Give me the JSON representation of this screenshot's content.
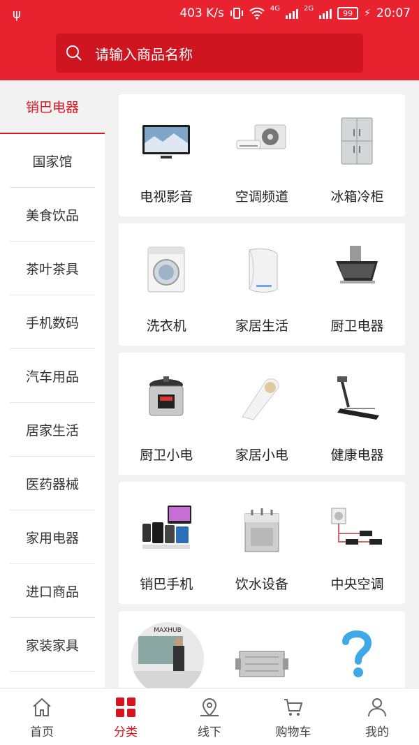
{
  "status_bar": {
    "usb_icon": "usb-icon",
    "speed": "403 K/s",
    "net_4g": "4G",
    "net_2g": "2G",
    "battery": "99",
    "time": "20:07"
  },
  "search": {
    "placeholder": "请输入商品名称",
    "icon": "search-icon"
  },
  "sidebar": {
    "items": [
      {
        "label": "销巴电器"
      },
      {
        "label": "国家馆"
      },
      {
        "label": "美食饮品"
      },
      {
        "label": "茶叶茶具"
      },
      {
        "label": "手机数码"
      },
      {
        "label": "汽车用品"
      },
      {
        "label": "居家生活"
      },
      {
        "label": "医药器械"
      },
      {
        "label": "家用电器"
      },
      {
        "label": "进口商品"
      },
      {
        "label": "家装家具"
      }
    ],
    "active": "销巴电器"
  },
  "categories": {
    "groups": [
      {
        "items": [
          {
            "label": "电视影音",
            "icon": "tv"
          },
          {
            "label": "空调频道",
            "icon": "air-conditioner"
          },
          {
            "label": "冰箱冷柜",
            "icon": "fridge"
          }
        ]
      },
      {
        "items": [
          {
            "label": "洗衣机",
            "icon": "washer"
          },
          {
            "label": "家居生活",
            "icon": "air-purifier"
          },
          {
            "label": "厨卫电器",
            "icon": "range-hood"
          }
        ]
      },
      {
        "items": [
          {
            "label": "厨卫小电",
            "icon": "pressure-cooker"
          },
          {
            "label": "家居小电",
            "icon": "hair-dryer"
          },
          {
            "label": "健康电器",
            "icon": "treadmill"
          }
        ]
      },
      {
        "items": [
          {
            "label": "销巴手机",
            "icon": "phones"
          },
          {
            "label": "饮水设备",
            "icon": "water-dispenser"
          },
          {
            "label": "中央空调",
            "icon": "central-ac"
          }
        ]
      },
      {
        "items": [
          {
            "label": "MAXHUB",
            "icon": "meeting-display"
          },
          {
            "label": "",
            "icon": "ventilator"
          },
          {
            "label": "",
            "icon": "question-mark"
          }
        ]
      }
    ]
  },
  "tabbar": {
    "items": [
      {
        "label": "首页",
        "icon": "home-icon"
      },
      {
        "label": "分类",
        "icon": "category-icon"
      },
      {
        "label": "线下",
        "icon": "map-pin-icon"
      },
      {
        "label": "购物车",
        "icon": "cart-icon"
      },
      {
        "label": "我的",
        "icon": "user-icon"
      }
    ],
    "active": "分类"
  },
  "colors": {
    "brand": "#e8232f",
    "active_text": "#d8141e",
    "background": "#f2f2f2"
  }
}
